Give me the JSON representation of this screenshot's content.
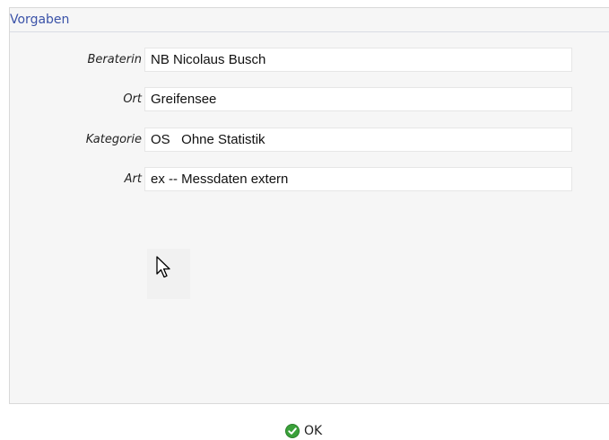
{
  "panel": {
    "title": "Vorgaben"
  },
  "fields": [
    {
      "label": "Beraterin",
      "value": "NB Nicolaus Busch"
    },
    {
      "label": "Ort",
      "value": "Greifensee"
    },
    {
      "label": "Kategorie",
      "value": "OS   Ohne Statistik"
    },
    {
      "label": "Art",
      "value": "ex -- Messdaten extern"
    }
  ],
  "actions": {
    "ok_label": "OK",
    "ok_icon": "check-circle-icon",
    "ok_icon_color": "#3aa13a"
  },
  "colors": {
    "accent": "#3a52a8",
    "panel_bg": "#f6f6f6"
  }
}
